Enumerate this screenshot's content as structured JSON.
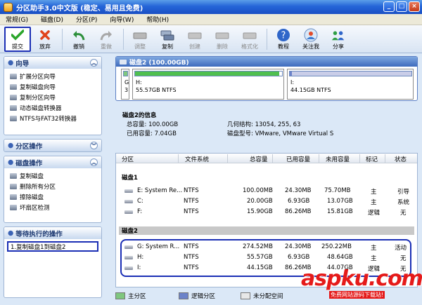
{
  "window": {
    "title": "分区助手3.0中文版 (稳定、易用且免费)",
    "controls": [
      "_",
      "□",
      "×"
    ]
  },
  "menu": [
    "常规(G)",
    "磁盘(D)",
    "分区(P)",
    "向导(W)",
    "帮助(H)"
  ],
  "toolbar": [
    {
      "label": "提交",
      "icon": "check-icon",
      "enabled": true
    },
    {
      "label": "放弃",
      "icon": "discard-icon",
      "enabled": true
    },
    {
      "label": "撤销",
      "icon": "undo-icon",
      "enabled": true
    },
    {
      "label": "重做",
      "icon": "redo-icon",
      "enabled": false
    },
    {
      "label": "调整",
      "icon": "resize-disk-icon",
      "enabled": false
    },
    {
      "label": "复制",
      "icon": "copy-disk-icon",
      "enabled": true
    },
    {
      "label": "创建",
      "icon": "create-disk-icon",
      "enabled": false
    },
    {
      "label": "删除",
      "icon": "delete-disk-icon",
      "enabled": false
    },
    {
      "label": "格式化",
      "icon": "format-disk-icon",
      "enabled": false
    },
    {
      "label": "教程",
      "icon": "help-icon",
      "enabled": true
    },
    {
      "label": "关注我",
      "icon": "follow-icon",
      "enabled": true
    },
    {
      "label": "分享",
      "icon": "share-icon",
      "enabled": true
    }
  ],
  "left": {
    "wizard": {
      "title": "向导",
      "items": [
        "扩展分区向导",
        "复制磁盘向导",
        "复制分区向导",
        "动态磁盘转换器",
        "NTFS与FAT32转换器"
      ]
    },
    "partition_ops": {
      "title": "分区操作"
    },
    "disk_ops": {
      "title": "磁盘操作",
      "items": [
        "复制磁盘",
        "删除所有分区",
        "擦除磁盘",
        "坏扇区检测"
      ]
    },
    "pending": {
      "title": "等待执行的操作",
      "item": "1.复制磁盘1到磁盘2"
    }
  },
  "disk_card": {
    "title": "磁盘2 (100.00GB)",
    "strips": [
      {
        "letter": "G",
        "index": "3"
      },
      {
        "name": "H:",
        "fs": "55.57GB NTFS",
        "fill": 0.98
      },
      {
        "name": "I:",
        "fs": "44.15GB NTFS",
        "fill": 0.02
      }
    ]
  },
  "disk_info": {
    "title": "磁盘2的信息",
    "total": "总容量: 100.00GB",
    "used": "已用容量: 7.04GB",
    "geometry": "几何结构: 13054, 255, 63",
    "model": "磁盘型号: VMware, VMware Virtual S"
  },
  "table": {
    "headers": [
      "分区",
      "文件系统",
      "总容量",
      "已用容量",
      "未用容量",
      "标记",
      "状态"
    ],
    "groups": [
      {
        "name": "磁盘1",
        "rows": [
          [
            "E:  System Re...",
            "NTFS",
            "100.00MB",
            "24.30MB",
            "75.70MB",
            "主",
            "引导"
          ],
          [
            "C:",
            "NTFS",
            "20.00GB",
            "6.93GB",
            "13.07GB",
            "主",
            "系统"
          ],
          [
            "F:",
            "NTFS",
            "15.90GB",
            "86.26MB",
            "15.81GB",
            "逻辑",
            "无"
          ]
        ]
      },
      {
        "name": "磁盘2",
        "rows": [
          [
            "G:  System R...",
            "NTFS",
            "274.52MB",
            "24.30MB",
            "250.22MB",
            "主",
            "活动"
          ],
          [
            "H:",
            "NTFS",
            "55.57GB",
            "6.93GB",
            "48.64GB",
            "主",
            "无"
          ],
          [
            "I:",
            "NTFS",
            "44.15GB",
            "86.26MB",
            "44.07GB",
            "逻辑",
            "无"
          ]
        ]
      }
    ]
  },
  "legend": [
    {
      "label": "主分区",
      "color": "#7fc77f"
    },
    {
      "label": "逻辑分区",
      "color": "#6b82c9"
    },
    {
      "label": "未分配空间",
      "color": "#e8e8e8"
    }
  ],
  "watermark": {
    "brand": "aspku.com",
    "tagline": "免费网站源码下载站!"
  }
}
